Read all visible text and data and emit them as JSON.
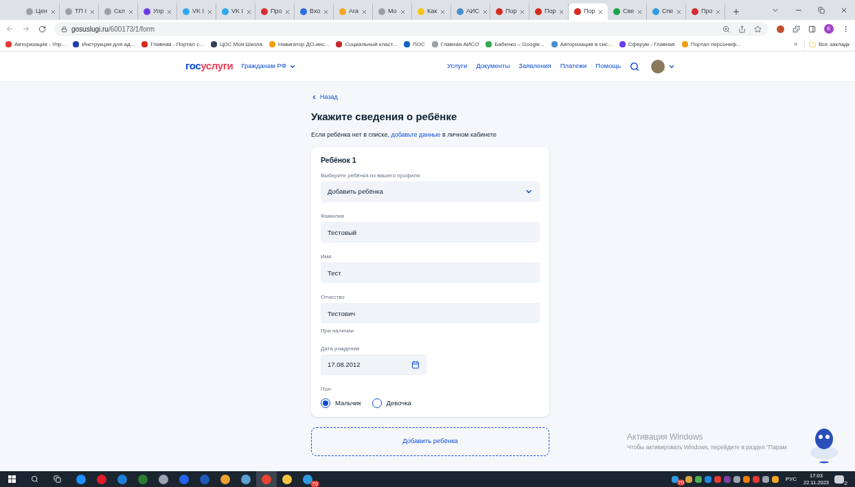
{
  "tabs": [
    {
      "title": "Цен",
      "color": "#9aa0a6",
      "selected": false
    },
    {
      "title": "ТП I",
      "color": "#9aa0a6",
      "selected": false
    },
    {
      "title": "Скл",
      "color": "#9aa0a6",
      "selected": false
    },
    {
      "title": "Упр",
      "color": "#6a3de8",
      "selected": false
    },
    {
      "title": "VK I",
      "color": "#2fa8f0",
      "selected": false
    },
    {
      "title": "VK I",
      "color": "#2fa8f0",
      "selected": false
    },
    {
      "title": "Про",
      "color": "#d62d30",
      "selected": false
    },
    {
      "title": "Вхо",
      "color": "#2f6be0",
      "selected": false
    },
    {
      "title": "Ага",
      "color": "#f5a623",
      "selected": false
    },
    {
      "title": "Мо",
      "color": "#9aa0a6",
      "selected": false
    },
    {
      "title": "Как",
      "color": "#f5c518",
      "selected": false
    },
    {
      "title": "АИС",
      "color": "#4a90c8",
      "selected": false
    },
    {
      "title": "Пор",
      "color": "#d52b1e",
      "selected": false
    },
    {
      "title": "Пор",
      "color": "#d52b1e",
      "selected": false
    },
    {
      "title": "Пор",
      "color": "#d52b1e",
      "selected": true
    },
    {
      "title": "Све",
      "color": "#16a34a",
      "selected": false
    },
    {
      "title": "Спе",
      "color": "#2f9ce0",
      "selected": false
    },
    {
      "title": "Про",
      "color": "#d62d30",
      "selected": false
    }
  ],
  "address": {
    "host": "gosuslugi.ru",
    "path": "/600173/1/form"
  },
  "profile": {
    "initial": "E"
  },
  "bookmarks": [
    {
      "title": "Авторизация - Упр...",
      "color": "#e53935"
    },
    {
      "title": "Инструкции для ад...",
      "color": "#1e40af"
    },
    {
      "title": "Главная - Портал с...",
      "color": "#d52b1e"
    },
    {
      "title": "ЦОС Моя Школа",
      "color": "#334155"
    },
    {
      "title": "Навигатор ДО-инс...",
      "color": "#f59e0b"
    },
    {
      "title": "Социальный класт...",
      "color": "#c62828"
    },
    {
      "title": "ПОС",
      "color": "#1565c0"
    },
    {
      "title": "Главная АИСО",
      "color": "#9aa0a6"
    },
    {
      "title": "Бабенко – Google...",
      "color": "#34a853"
    },
    {
      "title": "Авторизация в сис...",
      "color": "#4a90c8"
    },
    {
      "title": "Сферум - Главная",
      "color": "#6a3de8"
    },
    {
      "title": "Портал персониф...",
      "color": "#f59e0b"
    }
  ],
  "bookmarks_more": "»",
  "all_bookmarks": "Все закладк",
  "header": {
    "logo_first": "гос",
    "logo_second": "услуги",
    "citizens": "Гражданам РФ",
    "nav": [
      "Услуги",
      "Документы",
      "Заявления",
      "Платежи",
      "Помощь"
    ]
  },
  "back": "Назад",
  "title": "Укажите сведения о ребёнке",
  "intro": {
    "before": "Если ребёнка нет в списке,",
    "link": "добавьте данные",
    "after": "в личном кабинете"
  },
  "card": {
    "heading": "Ребёнок 1",
    "fields": [
      {
        "kind": "select",
        "label": "Выберите ребёнка из вашего профиля",
        "value": "Добавить ребёнка"
      },
      {
        "kind": "text",
        "label": "Фамилия",
        "value": "Тестовый"
      },
      {
        "kind": "text",
        "label": "Имя",
        "value": "Тест"
      },
      {
        "kind": "text",
        "label": "Отчество",
        "value": "Тестович",
        "hint": "При наличии"
      },
      {
        "kind": "date",
        "label": "Дата рождения",
        "value": "17.08.2012"
      },
      {
        "kind": "radio",
        "label": "Пол",
        "options": [
          {
            "label": "Мальчик",
            "selected": true
          },
          {
            "label": "Девочка",
            "selected": false
          }
        ]
      }
    ]
  },
  "add_child": "Добавить ребёнка",
  "activation": {
    "title": "Активация Windows",
    "text": "Чтобы активировать Windows, перейдите в раздел \"Парам"
  },
  "taskbar": {
    "apps": [
      {
        "color": "#1e90ff",
        "selected": false
      },
      {
        "color": "#e11d2a",
        "selected": false
      },
      {
        "color": "#1d7fd6",
        "selected": false
      },
      {
        "color": "#2e7d32",
        "selected": false
      },
      {
        "color": "#9ca3af",
        "selected": false
      },
      {
        "color": "#2563eb",
        "selected": false
      },
      {
        "color": "#1e5bb8",
        "selected": false
      },
      {
        "color": "#f0a030",
        "selected": false
      },
      {
        "color": "#5aa0d0",
        "selected": false
      },
      {
        "color": "#ea4335",
        "selected": true
      },
      {
        "color": "#f5c542",
        "selected": false
      },
      {
        "color": "#2f9ce0",
        "selected": false,
        "badge": "70"
      }
    ],
    "tray": [
      {
        "color": "#2f9ce0",
        "badge": "70"
      },
      {
        "color": "#d6a542"
      },
      {
        "color": "#4caf50"
      },
      {
        "color": "#1e88e5"
      },
      {
        "color": "#e53935"
      },
      {
        "color": "#7b3fa0"
      },
      {
        "color": "#9ca3af"
      },
      {
        "color": "#f57c00"
      },
      {
        "color": "#e53935"
      },
      {
        "color": "#9ca3af"
      },
      {
        "color": "#f5a623"
      }
    ],
    "language": "РУС",
    "time": "17:03",
    "date": "22.11.2023",
    "notifications": "2"
  }
}
